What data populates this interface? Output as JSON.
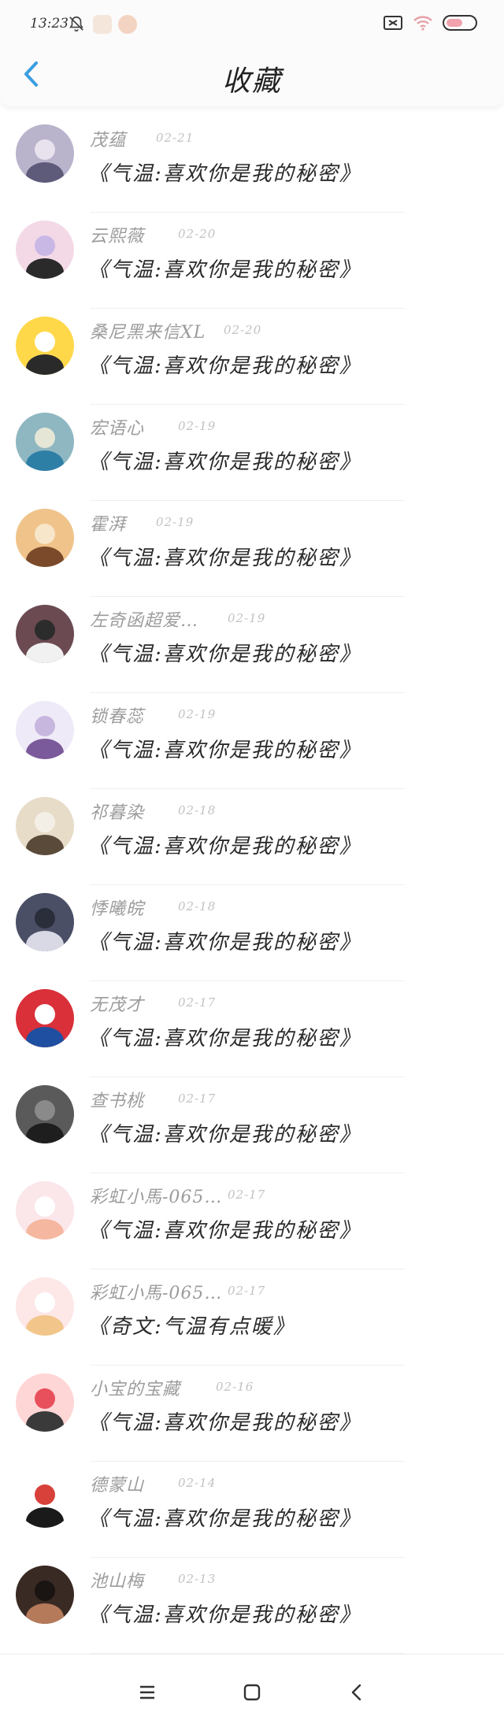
{
  "status_bar": {
    "time": "13:23",
    "icons": [
      "bell-off-icon",
      "app-notification-icon",
      "app-notification-icon",
      "screen-cast-icon",
      "wifi-icon",
      "battery-icon"
    ]
  },
  "header": {
    "title": "收藏",
    "back_icon": "chevron-left-icon",
    "accent_color": "#3a9ee0"
  },
  "items": [
    {
      "name": "茂蕴",
      "date": "02-21",
      "content": "《气温:喜欢你是我的秘密》"
    },
    {
      "name": "云熙薇",
      "date": "02-20",
      "content": "《气温:喜欢你是我的秘密》"
    },
    {
      "name": "桑尼黑来信XL",
      "date": "02-20",
      "content": "《气温:喜欢你是我的秘密》"
    },
    {
      "name": "宏语心",
      "date": "02-19",
      "content": "《气温:喜欢你是我的秘密》"
    },
    {
      "name": "霍湃",
      "date": "02-19",
      "content": "《气温:喜欢你是我的秘密》"
    },
    {
      "name": "左奇函超爱…",
      "date": "02-19",
      "content": "《气温:喜欢你是我的秘密》"
    },
    {
      "name": "锁春蕊",
      "date": "02-19",
      "content": "《气温:喜欢你是我的秘密》"
    },
    {
      "name": "祁暮染",
      "date": "02-18",
      "content": "《气温:喜欢你是我的秘密》"
    },
    {
      "name": "悸曦皖",
      "date": "02-18",
      "content": "《气温:喜欢你是我的秘密》"
    },
    {
      "name": "无茂才",
      "date": "02-17",
      "content": "《气温:喜欢你是我的秘密》"
    },
    {
      "name": "查书桃",
      "date": "02-17",
      "content": "《气温:喜欢你是我的秘密》"
    },
    {
      "name": "彩虹小馬-065…",
      "date": "02-17",
      "content": "《气温:喜欢你是我的秘密》"
    },
    {
      "name": "彩虹小馬-065…",
      "date": "02-17",
      "content": "《奇文:气温有点暖》"
    },
    {
      "name": "小宝的宝藏",
      "date": "02-16",
      "content": "《气温:喜欢你是我的秘密》"
    },
    {
      "name": "德蒙山",
      "date": "02-14",
      "content": "《气温:喜欢你是我的秘密》"
    },
    {
      "name": "池山梅",
      "date": "02-13",
      "content": "《气温:喜欢你是我的秘密》"
    }
  ],
  "bottom_nav": {
    "menu_icon": "menu-icon",
    "home_icon": "home-square-icon",
    "back_icon": "back-chevron-icon"
  }
}
